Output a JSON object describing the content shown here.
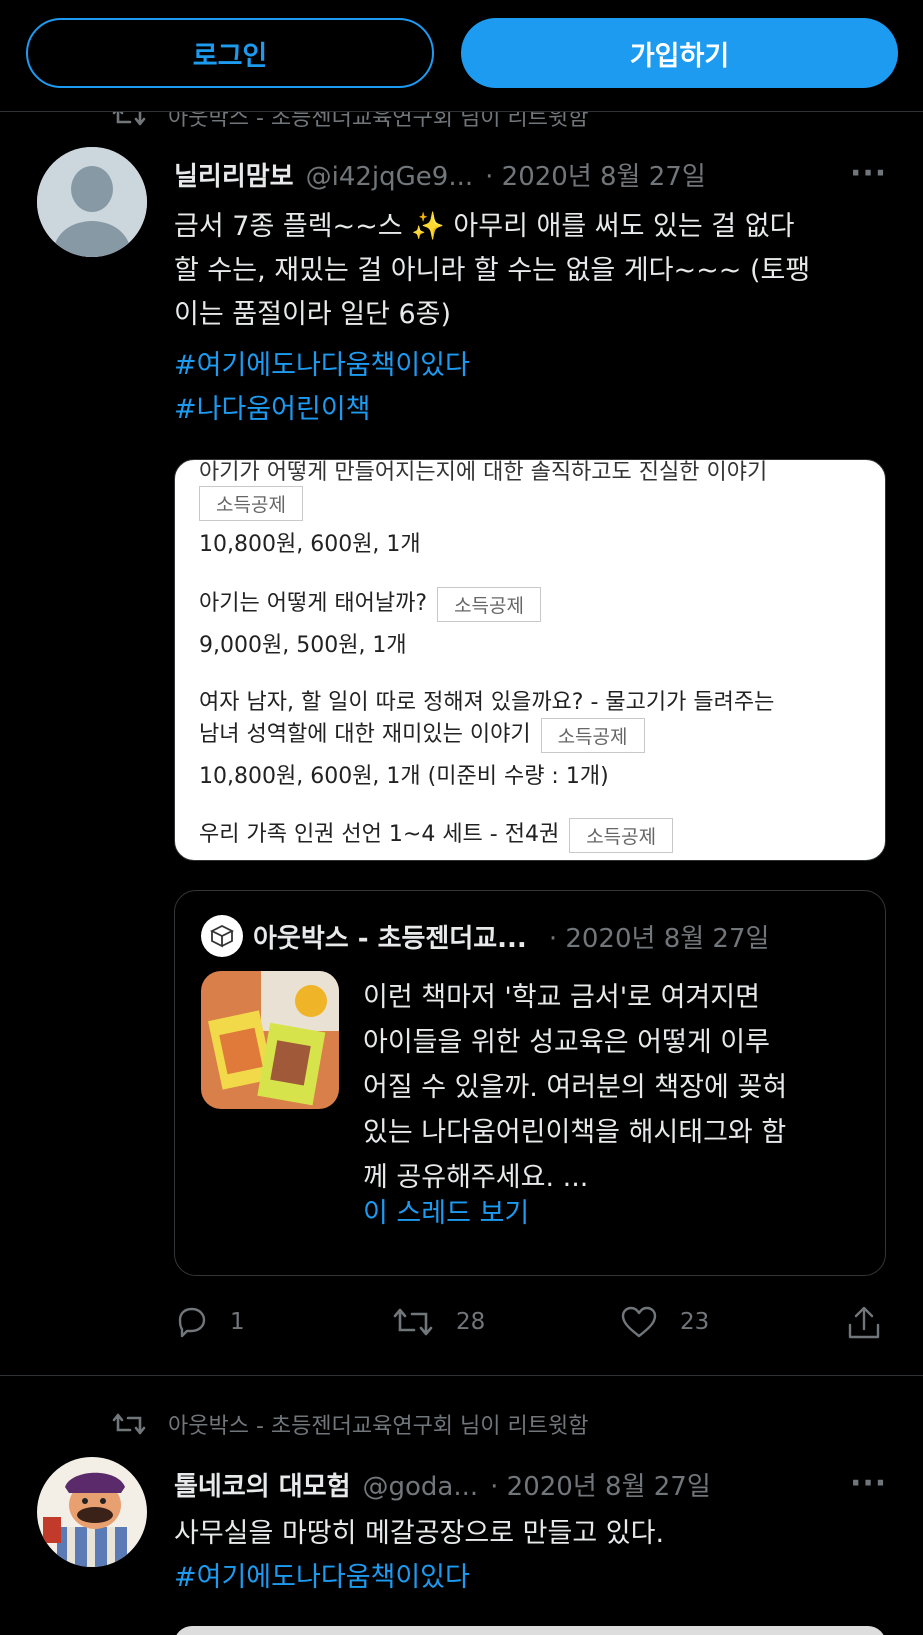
{
  "auth": {
    "login_label": "로그인",
    "signup_label": "가입하기"
  },
  "partial_retweet_line": "아웃박스 - 초등젠더교육연구회 님이 리트윗함",
  "tweet1": {
    "name": "닐리리맘보",
    "handle": "@i42jqGe9...",
    "date": "· 2020년 8월 27일",
    "more": "···",
    "text": "금서 7종 플렉~~스 ✨ 아무리 애를 써도 있는 걸 없다 할 수는, 재밌는 걸 아니라 할 수는 없을 게다~~~ (토팽이는 품절이라 일단 6종)",
    "lines": [
      "금서 7종 플렉~~스 ✨ 아무리 애를 써도 있는 걸 없다",
      "할 수는, 재밌는 걸 아니라 할 수는 없을 게다~~~ (토팽",
      "이는 품절이라 일단 6종)"
    ],
    "hashtags": [
      "#여기에도나다움책이있다",
      "#나다움어린이책"
    ],
    "media": {
      "line0": "아기가 어떻게 만들어지는지에 대한 솔직하고도 진실한 이야기",
      "tag": "소득공제",
      "price1": "10,800원, 600원, 1개",
      "item2": "아기는 어떻게 태어날까?",
      "price2": "9,000원, 500원, 1개",
      "item3a": "여자 남자, 할 일이 따로 정해져 있을까요? - 물고기가 들려주는",
      "item3b": "남녀 성역할에 대한 재미있는 이야기",
      "price3": "10,800원, 600원, 1개 (미준비 수량 : 1개)",
      "item4": "우리 가족 인권 선언 1~4 세트 - 전4권"
    },
    "quote": {
      "name": "아웃박스 - 초등젠더교...",
      "date": "· 2020년 8월 27일",
      "lines": [
        "이런 책마저 '학교 금서'로 여겨지면",
        "아이들을 위한 성교육은 어떻게 이루",
        "어질 수 있을까. 여러분의 책장에 꽂혀",
        "있는 나다움어린이책을 해시태그와 함",
        "께 공유해주세요. ..."
      ],
      "thread_link": "이 스레드 보기"
    },
    "actions": {
      "replies": "1",
      "retweets": "28",
      "likes": "23"
    }
  },
  "tweet2": {
    "retweet_line": "아웃박스 - 초등젠더교육연구회 님이 리트윗함",
    "name": "톨네코의 대모험",
    "handle": "@goda...",
    "date": "· 2020년 8월 27일",
    "more": "···",
    "text": "사무실을 마땅히 메갈공장으로 만들고 있다.",
    "hashtag": "#여기에도나다움책이있다"
  },
  "colors": {
    "accent": "#1d9bf0",
    "background": "#000000",
    "muted": "#71767b"
  }
}
